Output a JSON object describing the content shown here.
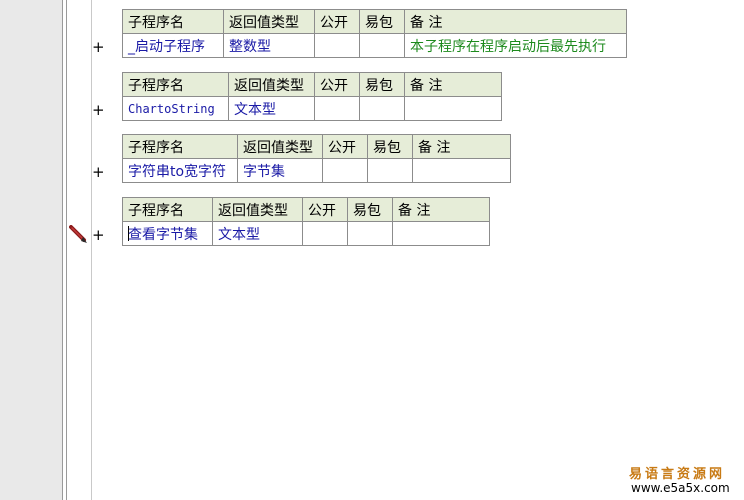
{
  "headers": {
    "name": "子程序名",
    "return_type": "返回值类型",
    "public": "公开",
    "easy_pack": "易包",
    "note": "备 注"
  },
  "expand_symbol": "+",
  "subroutines": [
    {
      "name": "_启动子程序",
      "return_type": "整数型",
      "public": "",
      "easy_pack": "",
      "note": "本子程序在程序启动后最先执行"
    },
    {
      "name": "ChartoString",
      "return_type": "文本型",
      "public": "",
      "easy_pack": "",
      "note": ""
    },
    {
      "name": "字符串to宽字符",
      "return_type": "字节集",
      "public": "",
      "easy_pack": "",
      "note": ""
    },
    {
      "name": "查看字节集",
      "return_type": "文本型",
      "public": "",
      "easy_pack": "",
      "note": ""
    }
  ],
  "watermark": {
    "chinese": "易语言资源网",
    "url": "www.e5a5x.com"
  },
  "colors": {
    "header_bg": "#e6edd8",
    "name_text": "#1a1aa6",
    "note_text": "#1d8a1d",
    "watermark_cn": "#c87a14"
  },
  "icons": [
    "expand-plus-icon",
    "pencil-edit-icon"
  ]
}
